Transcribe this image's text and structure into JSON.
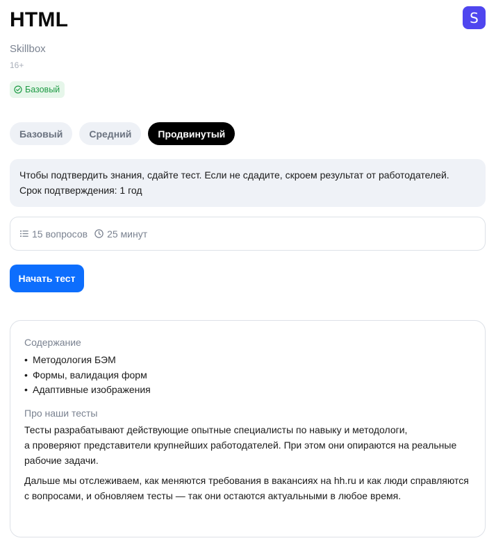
{
  "header": {
    "title": "HTML",
    "provider_logo_letter": "S",
    "provider_logo_color": "#4f46ef",
    "provider": "Skillbox",
    "age_rating": "16+",
    "badge": {
      "icon": "check-circle-icon",
      "label": "Базовый",
      "color": "#1f9b45"
    }
  },
  "levels": [
    {
      "label": "Базовый",
      "active": false
    },
    {
      "label": "Средний",
      "active": false
    },
    {
      "label": "Продвинутый",
      "active": true
    }
  ],
  "info": {
    "line1": "Чтобы подтвердить знания, сдайте тест. Если не сдадите, скроем результат от работодателей.",
    "line2": "Срок подтверждения: 1 год"
  },
  "stats": {
    "questions": {
      "icon": "list-icon",
      "label": "15 вопросов"
    },
    "duration": {
      "icon": "clock-icon",
      "label": "25 минут"
    }
  },
  "start_button": {
    "label": "Начать тест",
    "color": "#0d6efd"
  },
  "content": {
    "heading": "Содержание",
    "topics": [
      "Методология БЭМ",
      "Формы, валидация форм",
      "Адаптивные изображения"
    ],
    "about_heading": "Про наши тесты",
    "paragraph1": "Тесты разрабатывают действующие опытные специалисты по навыку и методологи,\nа проверяют представители крупнейших работодателей. При этом они опираются на реальные рабочие задачи.",
    "paragraph2": "Дальше мы отслеживаем, как меняются требования в вакансиях на hh.ru и как люди справляются с вопросами, и обновляем тесты — так они остаются актуальными в любое время."
  }
}
